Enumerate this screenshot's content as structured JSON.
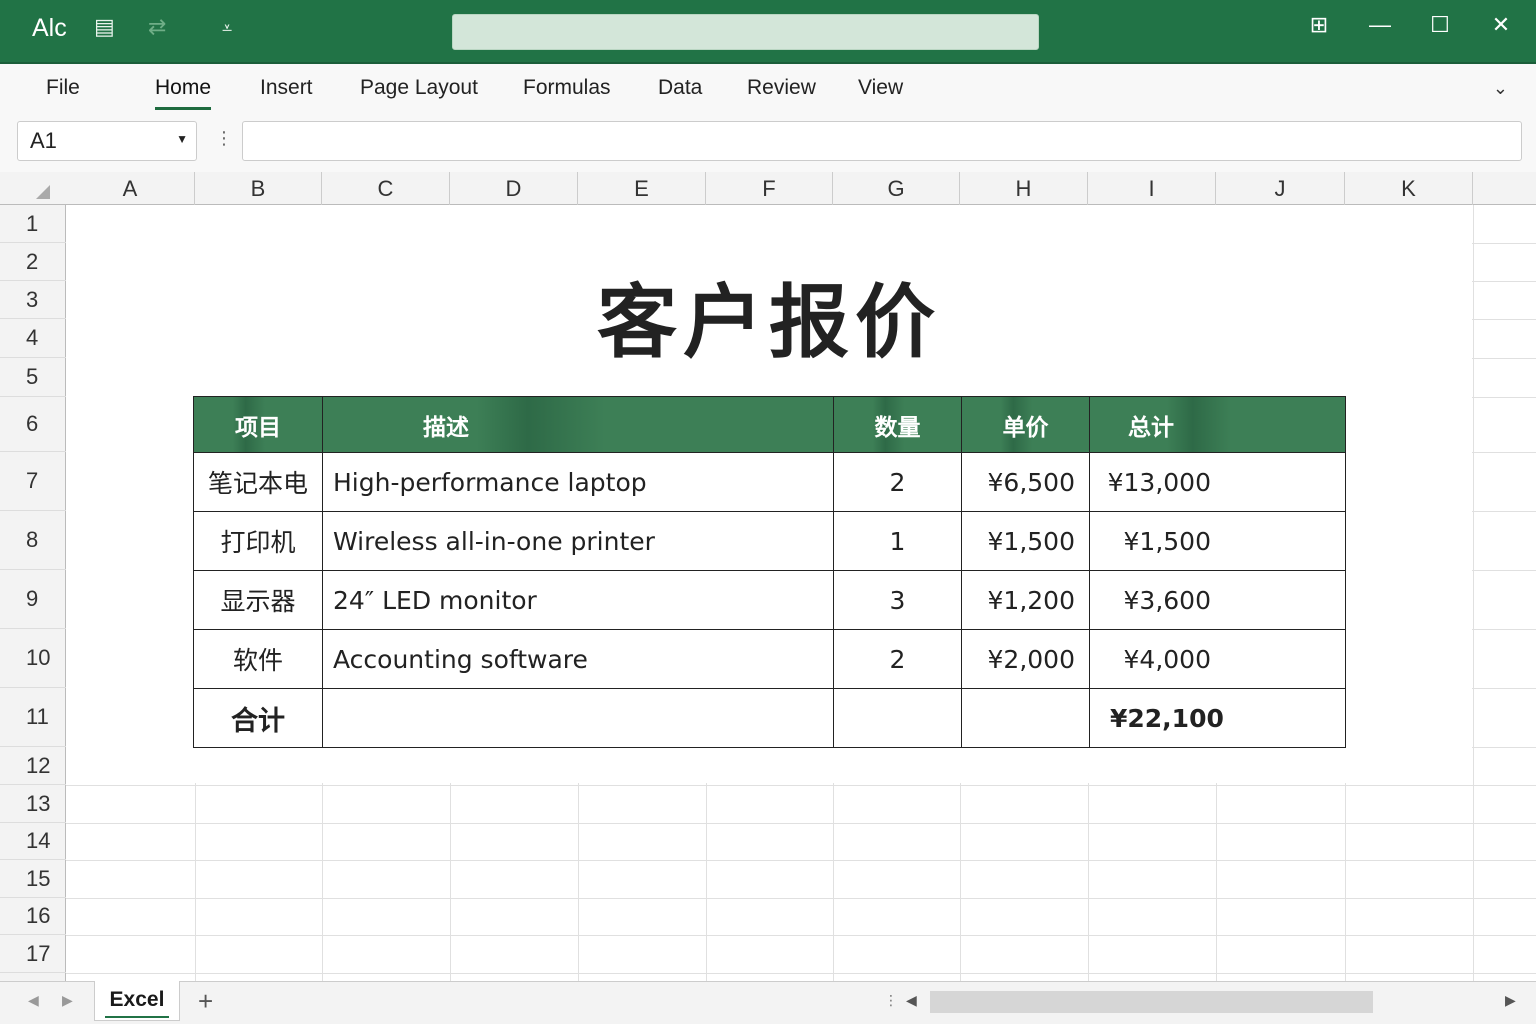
{
  "titlebar": {
    "app_label": "Alc",
    "icons": [
      "save-layout-icon",
      "redo-icon",
      "customize-qat-icon"
    ],
    "window_buttons": [
      "ribbon-display-icon",
      "minimize-icon",
      "maximize-icon",
      "close-icon"
    ]
  },
  "ribbon": {
    "tabs": [
      "File",
      "Home",
      "Insert",
      "Page Layout",
      "Formulas",
      "Data",
      "Review",
      "View"
    ],
    "active_tab": "Home"
  },
  "formula_bar": {
    "name_box": "A1",
    "formula": ""
  },
  "columns": [
    "A",
    "B",
    "C",
    "D",
    "E",
    "F",
    "G",
    "H",
    "I",
    "J",
    "K"
  ],
  "rows": [
    "1",
    "2",
    "3",
    "4",
    "5",
    "6",
    "7",
    "8",
    "9",
    "10",
    "11",
    "12",
    "13",
    "14",
    "15",
    "16",
    "17"
  ],
  "sheet": {
    "title": "客户报价",
    "headers": [
      "项目",
      "描述",
      "数量",
      "单价",
      "总计"
    ],
    "items": [
      {
        "item": "笔记本电",
        "desc": "High-performance laptop",
        "qty": "2",
        "price": "¥6,500",
        "total": "¥13,000"
      },
      {
        "item": "打印机",
        "desc": "Wireless all-in-one printer",
        "qty": "1",
        "price": "¥1,500",
        "total": "¥1,500"
      },
      {
        "item": "显示器",
        "desc": "24″ LED monitor",
        "qty": "3",
        "price": "¥1,200",
        "total": "¥3,600"
      },
      {
        "item": "软件",
        "desc": "Accounting software",
        "qty": "2",
        "price": "¥2,000",
        "total": "¥4,000"
      }
    ],
    "total_label": "合计",
    "grand_total": "¥22,100"
  },
  "sheet_tabs": {
    "active": "Excel",
    "add": "+"
  },
  "colors": {
    "brand": "#217346",
    "header_fill": "#3d7f56"
  }
}
